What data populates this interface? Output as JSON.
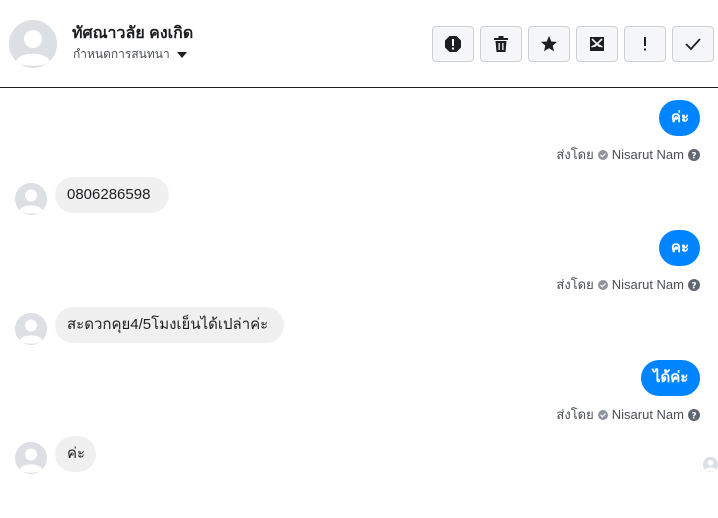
{
  "header": {
    "contact_name": "ทัศณาวลัย คงเกิด",
    "assign_label": "กำหนดการสนทนา",
    "toolbar": [
      {
        "name": "report-button",
        "icon": "alert-octagon-icon"
      },
      {
        "name": "delete-button",
        "icon": "trash-icon"
      },
      {
        "name": "star-button",
        "icon": "star-icon"
      },
      {
        "name": "mark-unread-button",
        "icon": "envelope-x-icon"
      },
      {
        "name": "spam-button",
        "icon": "exclamation-icon"
      },
      {
        "name": "done-button",
        "icon": "check-icon"
      }
    ]
  },
  "messages": [
    {
      "direction": "outgoing",
      "text": "ค่ะ",
      "sent_by_prefix": "ส่งโดย",
      "sent_by_agent": "Nisarut Nam"
    },
    {
      "direction": "incoming",
      "text": "0806286598"
    },
    {
      "direction": "outgoing",
      "text": "คะ",
      "sent_by_prefix": "ส่งโดย",
      "sent_by_agent": "Nisarut Nam"
    },
    {
      "direction": "incoming",
      "text": "สะดวกคุย4/5โมงเย็นได้เปล่าค่ะ"
    },
    {
      "direction": "outgoing",
      "text": "ได้ค่ะ",
      "sent_by_prefix": "ส่งโดย",
      "sent_by_agent": "Nisarut Nam"
    },
    {
      "direction": "incoming",
      "text": "ค่ะ"
    }
  ],
  "colors": {
    "outgoing_bubble": "#0084ff",
    "incoming_bubble": "#f1f0f0",
    "button_bg": "#f5f6f7",
    "avatar_bg": "#dcdfe4"
  }
}
